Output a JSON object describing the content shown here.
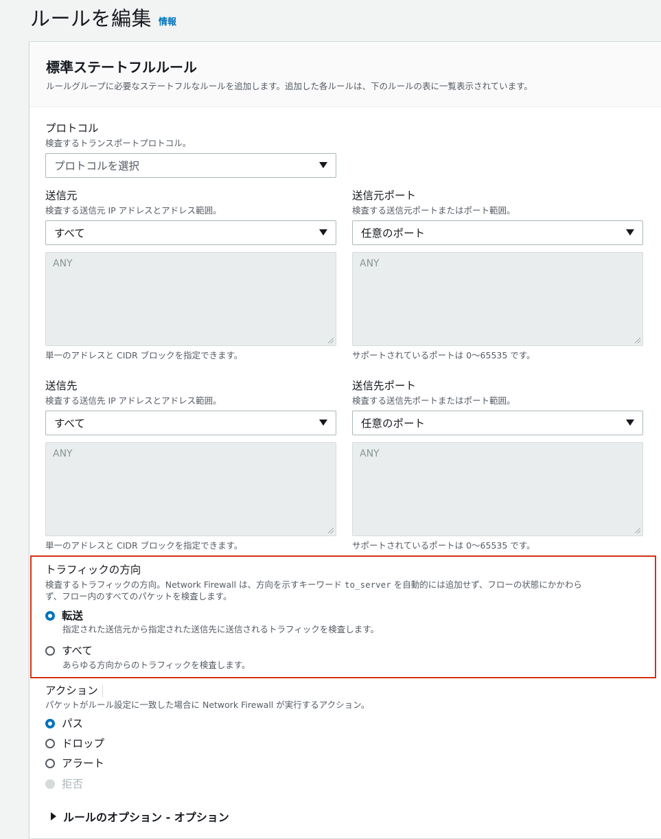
{
  "page": {
    "title": "ルールを編集",
    "info_link": "情報"
  },
  "section": {
    "title": "標準ステートフルルール",
    "description": "ルールグループに必要なステートフルなルールを追加します。追加した各ルールは、下のルールの表に一覧表示されています。"
  },
  "protocol": {
    "label": "プロトコル",
    "description": "検査するトランスポートプロトコル。",
    "placeholder": "プロトコルを選択"
  },
  "source": {
    "label": "送信元",
    "description": "検査する送信元 IP アドレスとアドレス範囲。",
    "selected": "すべて",
    "textarea_value": "ANY",
    "hint": "単一のアドレスと CIDR ブロックを指定できます。"
  },
  "source_port": {
    "label": "送信元ポート",
    "description": "検査する送信元ポートまたはポート範囲。",
    "selected": "任意のポート",
    "textarea_value": "ANY",
    "hint": "サポートされているポートは 0～65535 です。"
  },
  "destination": {
    "label": "送信先",
    "description": "検査する送信先 IP アドレスとアドレス範囲。",
    "selected": "すべて",
    "textarea_value": "ANY",
    "hint": "単一のアドレスと CIDR ブロックを指定できます。"
  },
  "destination_port": {
    "label": "送信先ポート",
    "description": "検査する送信先ポートまたはポート範囲。",
    "selected": "任意のポート",
    "textarea_value": "ANY",
    "hint": "サポートされているポートは 0～65535 です。"
  },
  "traffic_direction": {
    "label": "トラフィックの方向",
    "description_part1": "検査するトラフィックの方向。Network Firewall は、方向を示すキーワード ",
    "keyword": "to_server",
    "description_part2": " を自動的には追加せず、フローの状態にかかわら",
    "description_line2": "ず、フロー内のすべてのパケットを検査します。",
    "options": [
      {
        "label": "転送",
        "description": "指定された送信元から指定された送信先に送信されるトラフィックを検査します。",
        "checked": true
      },
      {
        "label": "すべて",
        "description": "あらゆる方向からのトラフィックを検査します。",
        "checked": false
      }
    ]
  },
  "action": {
    "label": "アクション",
    "description": "パケットがルール設定に一致した場合に Network Firewall が実行するアクション。",
    "options": [
      {
        "label": "パス",
        "checked": true,
        "disabled": false
      },
      {
        "label": "ドロップ",
        "checked": false,
        "disabled": false
      },
      {
        "label": "アラート",
        "checked": false,
        "disabled": false
      },
      {
        "label": "拒否",
        "checked": false,
        "disabled": true
      }
    ]
  },
  "rule_options": {
    "label": "ルールのオプション - オプション"
  },
  "colors": {
    "accent": "#0073bb",
    "highlight": "#d13212"
  }
}
